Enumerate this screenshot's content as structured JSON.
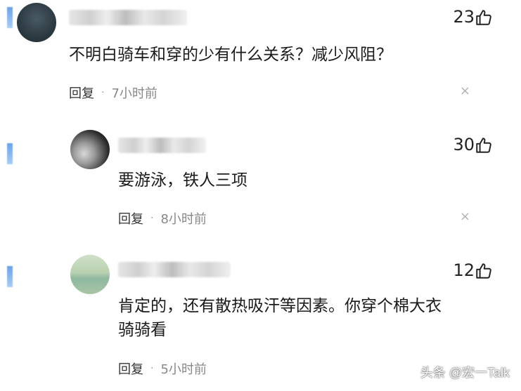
{
  "comments": [
    {
      "text": "不明白骑车和穿的少有什么关系？减少风阻？",
      "likes": "23",
      "reply_label": "回复",
      "separator": "·",
      "time": "7小时前",
      "close_icon": "×"
    },
    {
      "text": "要游泳，铁人三项",
      "likes": "30",
      "reply_label": "回复",
      "separator": "·",
      "time": "8小时前",
      "close_icon": "×"
    },
    {
      "text": "肯定的，还有散热吸汗等因素。你穿个棉大衣\n骑骑看",
      "likes": "12",
      "reply_label": "回复",
      "separator": "·",
      "time": "5小时前"
    }
  ],
  "watermark": "头条 @宏一Talk"
}
